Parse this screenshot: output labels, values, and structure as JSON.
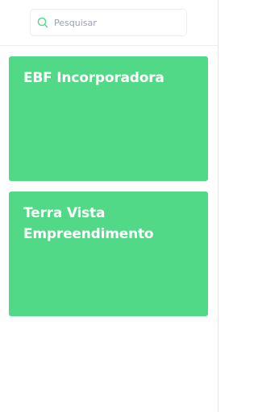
{
  "search": {
    "placeholder": "Pesquisar",
    "value": "",
    "icon": "search-icon",
    "icon_color": "#52d987"
  },
  "cards": [
    {
      "title": "EBF Incorporadora"
    },
    {
      "title": "Terra Vista Empreendimento"
    }
  ],
  "colors": {
    "card_background": "#52d987",
    "card_text": "#ffffff",
    "placeholder_text": "#9a9fb4"
  }
}
